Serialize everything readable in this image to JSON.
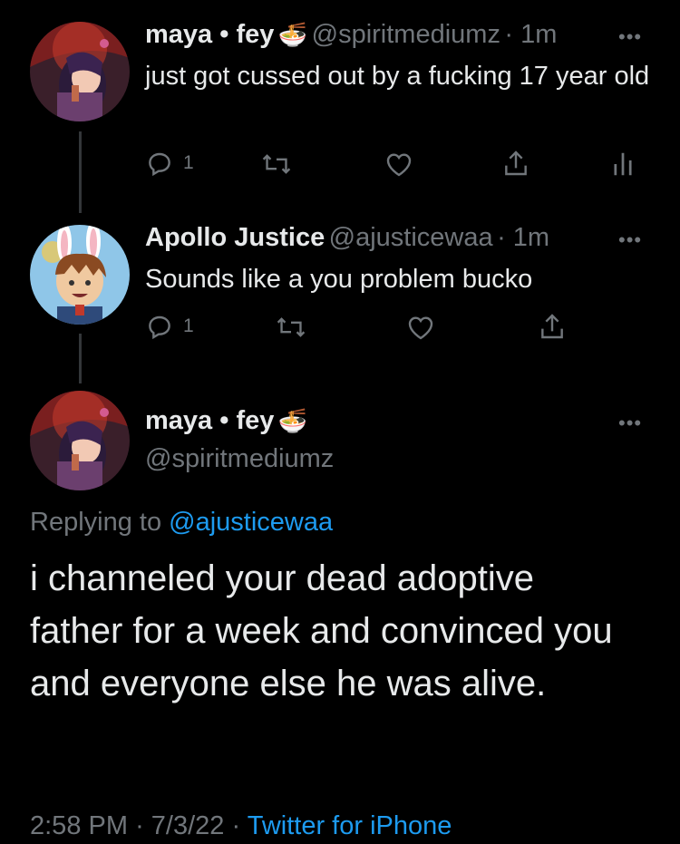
{
  "tweet1": {
    "name": "maya • fey",
    "emoji": "🍜",
    "handle": "@spiritmediumz",
    "time": "· 1m",
    "text": "just got cussed out by a fucking 17 year old",
    "replies": "1"
  },
  "tweet2": {
    "name": "Apollo Justice",
    "handle": "@ajusticewaa",
    "time": "· 1m",
    "text": "Sounds like a you problem bucko",
    "replies": "1"
  },
  "main": {
    "name": "maya • fey",
    "emoji": "🍜",
    "handle": "@spiritmediumz",
    "replying_prefix": "Replying to",
    "replying_handle": "@ajusticewaa",
    "text": "i channeled your dead adoptive father for a week and convinced you and everyone else he was alive.",
    "time": "2:58 PM",
    "date": "7/3/22",
    "source": "Twitter for iPhone"
  },
  "icons": [
    "reply-icon",
    "retweet-icon",
    "like-icon",
    "share-icon",
    "analytics-icon",
    "more-icon"
  ],
  "colors": {
    "background": "#000000",
    "text": "#e7e9ea",
    "secondary": "#71767b",
    "link": "#1d9bf0"
  }
}
